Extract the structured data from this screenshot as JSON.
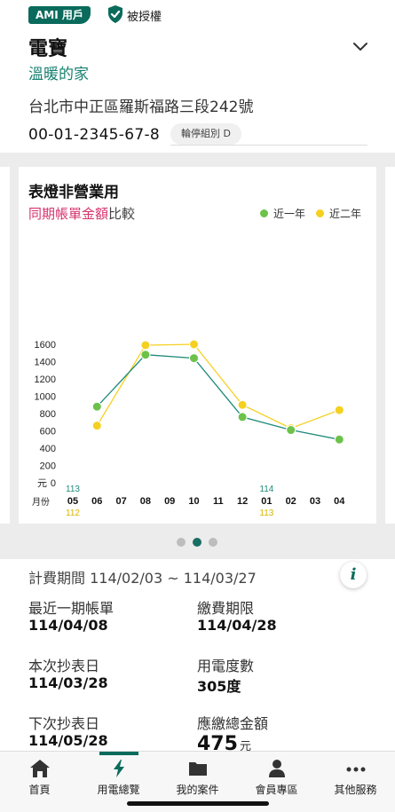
{
  "header": {
    "badge": "AMI 用戶",
    "auth_label": "被授權",
    "title": "電寶",
    "subtitle": "溫暖的家",
    "address": "台北市中正區羅斯福路三段242號",
    "account_number": "00-01-2345-67-8",
    "group_label": "輪停組別 D"
  },
  "card": {
    "title": "表燈非營業用",
    "subtitle_red": "同期帳單金額",
    "subtitle_gray": "比較"
  },
  "colors": {
    "brand": "#0a6b5c",
    "recent_year": "#6cc24a",
    "prior_year": "#f5d020",
    "accent_red": "#d6336c"
  },
  "chart_data": {
    "type": "line",
    "title": "表燈非營業用",
    "y_unit_label": "元",
    "x_unit_label": "月份",
    "categories": [
      "05",
      "06",
      "07",
      "08",
      "09",
      "10",
      "11",
      "12",
      "01",
      "02",
      "03",
      "04"
    ],
    "year_markers": [
      {
        "category": "05",
        "top": "113",
        "bottom": "112"
      },
      {
        "category": "01",
        "top": "114",
        "bottom": "113"
      }
    ],
    "y_ticks": [
      0,
      200,
      400,
      600,
      800,
      1000,
      1200,
      1400,
      1600
    ],
    "ylim": [
      0,
      1650
    ],
    "series": [
      {
        "name": "近一年",
        "color": "#6cc24a",
        "line_color": "#1f8a7a",
        "points": [
          {
            "x": "06",
            "y": 880
          },
          {
            "x": "08",
            "y": 1480
          },
          {
            "x": "10",
            "y": 1440
          },
          {
            "x": "12",
            "y": 760
          },
          {
            "x": "02",
            "y": 610
          },
          {
            "x": "04",
            "y": 500
          }
        ]
      },
      {
        "name": "近二年",
        "color": "#f5d020",
        "line_color": "#f5d020",
        "points": [
          {
            "x": "06",
            "y": 660
          },
          {
            "x": "08",
            "y": 1590
          },
          {
            "x": "10",
            "y": 1600
          },
          {
            "x": "12",
            "y": 900
          },
          {
            "x": "02",
            "y": 630
          },
          {
            "x": "04",
            "y": 840
          }
        ]
      }
    ],
    "legend_position": "top-right",
    "grid": false
  },
  "carousel": {
    "pages": 3,
    "active_index": 1
  },
  "billing": {
    "period_label": "計費期間 114/02/03 ~ 114/03/27",
    "latest_bill_label": "最近一期帳單",
    "latest_bill_value": "114/04/08",
    "due_label": "繳費期限",
    "due_value": "114/04/28",
    "read_date_label": "本次抄表日",
    "read_date_value": "114/03/28",
    "usage_label": "用電度數",
    "usage_value": "305度",
    "next_read_label": "下次抄表日",
    "next_read_value": "114/05/28",
    "amount_label": "應繳總金額",
    "amount_value": "475",
    "amount_unit": "元"
  },
  "nav": {
    "items": [
      {
        "label": "首頁",
        "icon": "home-icon"
      },
      {
        "label": "用電總覽",
        "icon": "lightning-icon"
      },
      {
        "label": "我的案件",
        "icon": "folder-icon"
      },
      {
        "label": "會員專區",
        "icon": "person-icon"
      },
      {
        "label": "其他服務",
        "icon": "more-icon"
      }
    ],
    "active_index": 1
  }
}
